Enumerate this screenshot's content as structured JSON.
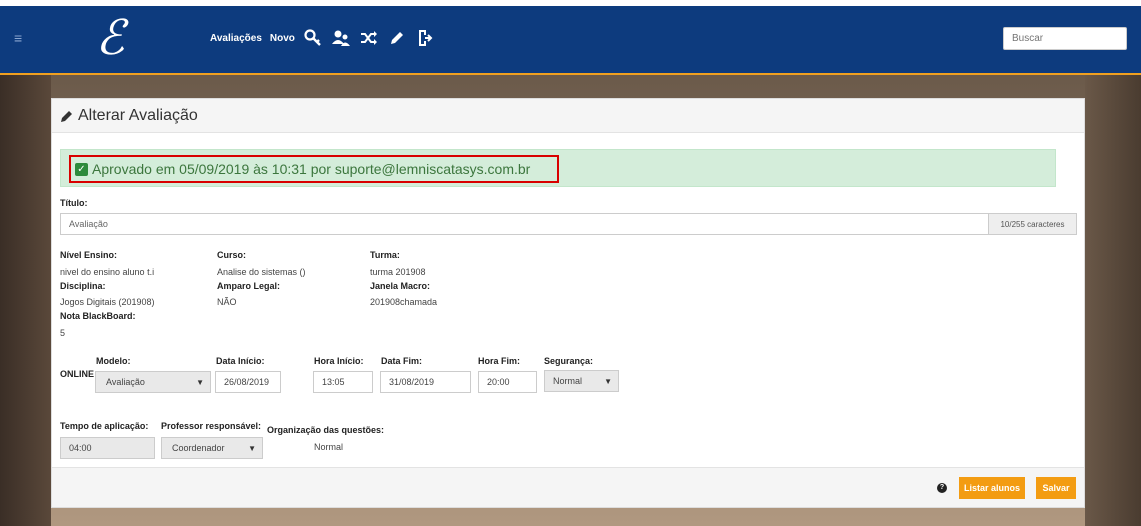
{
  "nav": {
    "avaliacoes": "Avaliações",
    "novo": "Novo",
    "icons": [
      "search-key-icon",
      "users-icon",
      "shuffle-icon",
      "pencil-icon",
      "logout-icon"
    ]
  },
  "search": {
    "placeholder": "Buscar"
  },
  "panel": {
    "title": "Alterar Avaliação"
  },
  "alert": {
    "text": "Aprovado em 05/09/2019 às 10:31 por suporte@lemniscatasys.com.br"
  },
  "form": {
    "titulo_label": "Título:",
    "titulo_value": "Avaliação",
    "counter": "10/255 caracteres",
    "nivel_label": "Nível Ensino:",
    "nivel_value": "nivel do ensino aluno t.i",
    "curso_label": "Curso:",
    "curso_value": "Analise do sistemas ()",
    "turma_label": "Turma:",
    "turma_value": "turma 201908",
    "disciplina_label": "Disciplina:",
    "disciplina_value": "Jogos Digitais (201908)",
    "amparo_label": "Amparo Legal:",
    "amparo_value": "NÃO",
    "janela_label": "Janela Macro:",
    "janela_value": "201908chamada",
    "nota_label": "Nota BlackBoard:",
    "nota_value": "5",
    "online_label": "ONLINE",
    "modelo_label": "Modelo:",
    "modelo_value": "Avaliação",
    "data_inicio_label": "Data Início:",
    "data_inicio_value": "26/08/2019",
    "hora_inicio_label": "Hora Início:",
    "hora_inicio_value": "13:05",
    "data_fim_label": "Data Fim:",
    "data_fim_value": "31/08/2019",
    "hora_fim_label": "Hora Fim:",
    "hora_fim_value": "20:00",
    "seguranca_label": "Segurança:",
    "seguranca_value": "Normal",
    "tempo_label": "Tempo de aplicação:",
    "tempo_value": "04:00",
    "professor_label": "Professor responsável:",
    "professor_value": "Coordenador",
    "organizacao_label": "Organização das questões:",
    "organizacao_value": "Normal"
  },
  "footer": {
    "listar_label": "Listar alunos",
    "salvar_label": "Salvar"
  },
  "colors": {
    "navbar": "#0d3b7e",
    "accent": "#f39c12",
    "alert_bg": "#d4edda",
    "alert_border": "#d90000"
  }
}
